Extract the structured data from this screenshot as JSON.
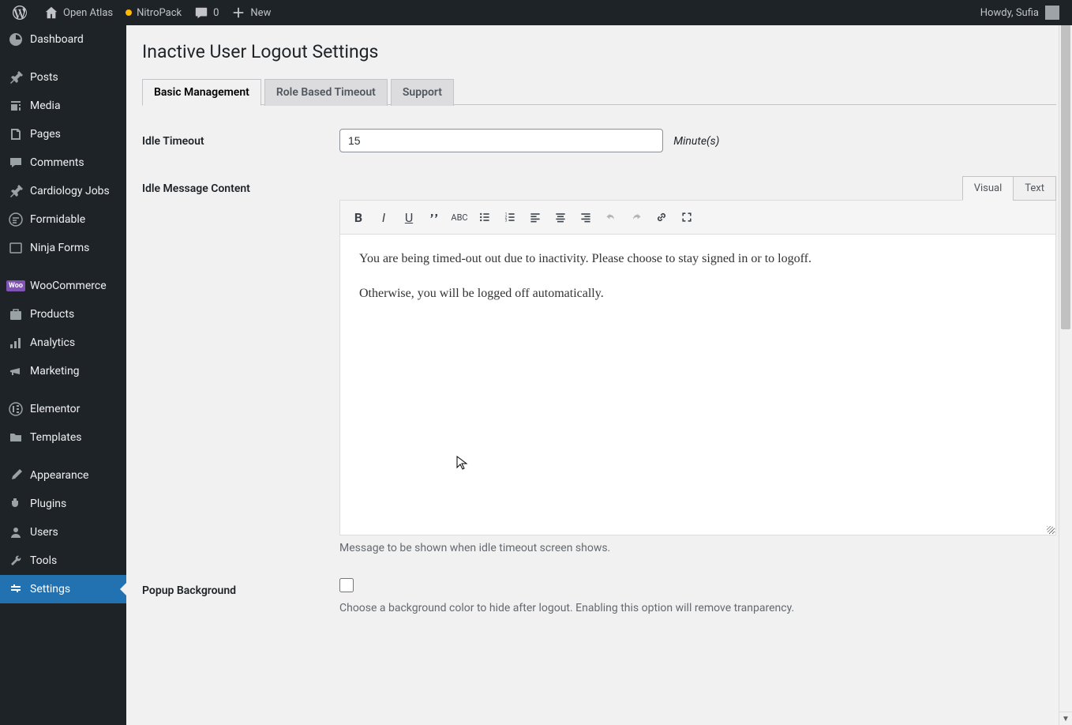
{
  "adminbar": {
    "site_name": "Open Atlas",
    "nitropack": "NitroPack",
    "comment_count": "0",
    "new_label": "New",
    "howdy": "Howdy, Sufia"
  },
  "sidebar": {
    "items": [
      {
        "label": "Dashboard"
      },
      {
        "label": "Posts"
      },
      {
        "label": "Media"
      },
      {
        "label": "Pages"
      },
      {
        "label": "Comments"
      },
      {
        "label": "Cardiology Jobs"
      },
      {
        "label": "Formidable"
      },
      {
        "label": "Ninja Forms"
      },
      {
        "label": "WooCommerce"
      },
      {
        "label": "Products"
      },
      {
        "label": "Analytics"
      },
      {
        "label": "Marketing"
      },
      {
        "label": "Elementor"
      },
      {
        "label": "Templates"
      },
      {
        "label": "Appearance"
      },
      {
        "label": "Plugins"
      },
      {
        "label": "Users"
      },
      {
        "label": "Tools"
      },
      {
        "label": "Settings"
      }
    ]
  },
  "page": {
    "title": "Inactive User Logout Settings",
    "tabs": [
      {
        "label": "Basic Management"
      },
      {
        "label": "Role Based Timeout"
      },
      {
        "label": "Support"
      }
    ]
  },
  "form": {
    "idle_timeout": {
      "label": "Idle Timeout",
      "value": "15",
      "unit": "Minute(s)"
    },
    "idle_message": {
      "label": "Idle Message Content",
      "editor_tabs": {
        "visual": "Visual",
        "text": "Text"
      },
      "content_p1": "You are being timed-out out due to inactivity. Please choose to stay signed in or to logoff.",
      "content_p2": "Otherwise, you will be logged off automatically.",
      "description": "Message to be shown when idle timeout screen shows."
    },
    "popup_bg": {
      "label": "Popup Background",
      "description": "Choose a background color to hide after logout. Enabling this option will remove tranparency."
    }
  }
}
